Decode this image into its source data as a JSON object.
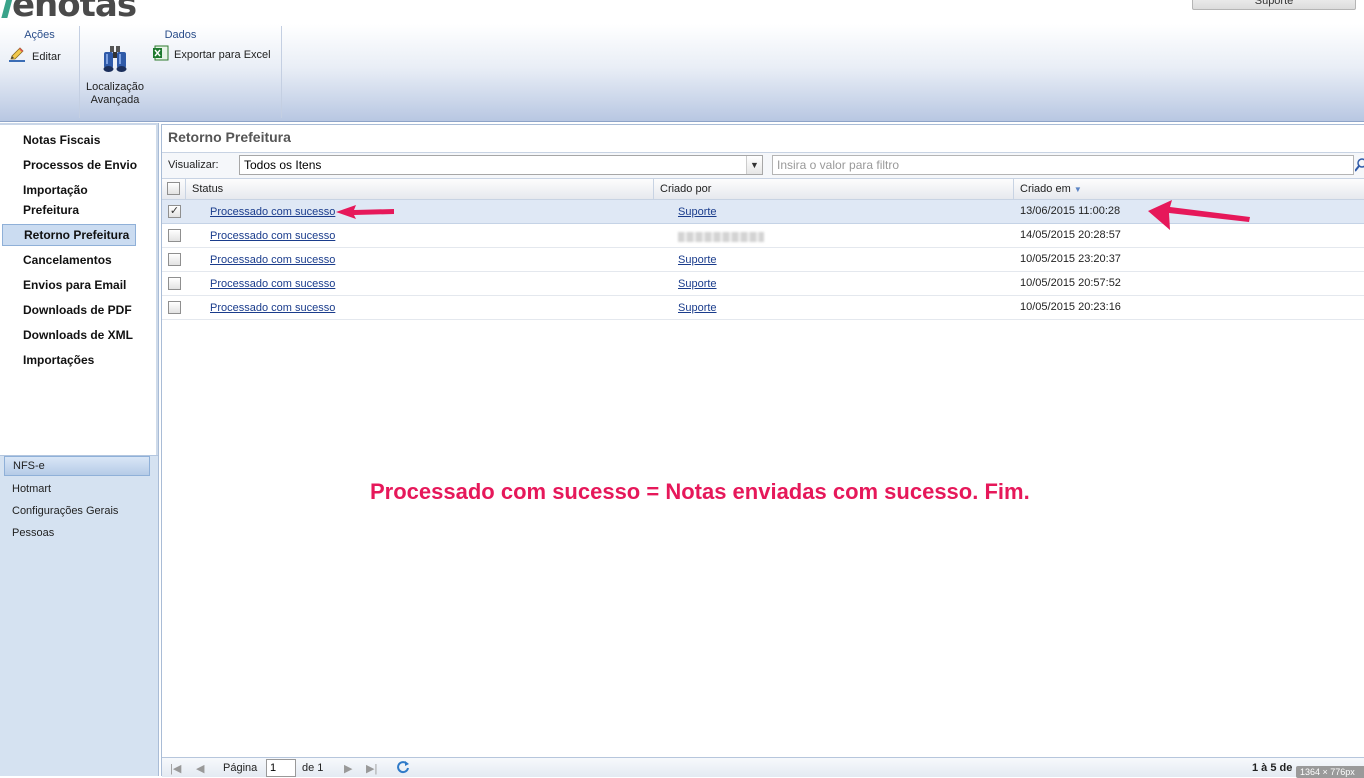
{
  "app": {
    "logo": "enotas",
    "user_menu": "Suporte"
  },
  "ribbon": {
    "acoes": {
      "title": "Ações",
      "editar": "Editar"
    },
    "dados": {
      "title": "Dados",
      "exportar": "Exportar para Excel",
      "localizacao_1": "Localização",
      "localizacao_2": "Avançada"
    }
  },
  "nav": {
    "items": [
      {
        "label": "Notas Fiscais"
      },
      {
        "label": "Processos de Envio"
      },
      {
        "label": "Importação"
      },
      {
        "label": "Prefeitura"
      },
      {
        "label": "Retorno Prefeitura"
      },
      {
        "label": "Cancelamentos"
      },
      {
        "label": "Envios para Email"
      },
      {
        "label": "Downloads de PDF"
      },
      {
        "label": "Downloads de XML"
      },
      {
        "label": "Importações"
      }
    ],
    "modules": [
      {
        "label": "NFS-e"
      },
      {
        "label": "Hotmart"
      },
      {
        "label": "Configurações Gerais"
      },
      {
        "label": "Pessoas"
      }
    ]
  },
  "main": {
    "title": "Retorno Prefeitura",
    "view_label": "Visualizar:",
    "view_value": "Todos os Itens",
    "filter_placeholder": "Insira o valor para filtro",
    "columns": {
      "status": "Status",
      "criado_por": "Criado por",
      "criado_em": "Criado em"
    },
    "rows": [
      {
        "status": "Processado com sucesso",
        "criado_por": "Suporte",
        "criado_em": "13/06/2015 11:00:28",
        "checked": true
      },
      {
        "status": "Processado com sucesso",
        "criado_por": "",
        "criado_em": "14/05/2015 20:28:57",
        "checked": false
      },
      {
        "status": "Processado com sucesso",
        "criado_por": "Suporte",
        "criado_em": "10/05/2015 23:20:37",
        "checked": false
      },
      {
        "status": "Processado com sucesso",
        "criado_por": "Suporte",
        "criado_em": "10/05/2015 20:57:52",
        "checked": false
      },
      {
        "status": "Processado com sucesso",
        "criado_por": "Suporte",
        "criado_em": "10/05/2015 20:23:16",
        "checked": false
      }
    ],
    "annotation": "Processado com sucesso = Notas enviadas com sucesso. Fim."
  },
  "footer": {
    "page_label": "Página",
    "page_value": "1",
    "of_label": "de 1",
    "range": "1 à 5 de"
  },
  "overlay": {
    "dims": "1364 × 776px"
  },
  "colors": {
    "annotation": "#e6185a",
    "link": "#1a3c8c",
    "ribbon_bottom": "#b8c7e2",
    "nav_bg": "#d5e2f1"
  }
}
